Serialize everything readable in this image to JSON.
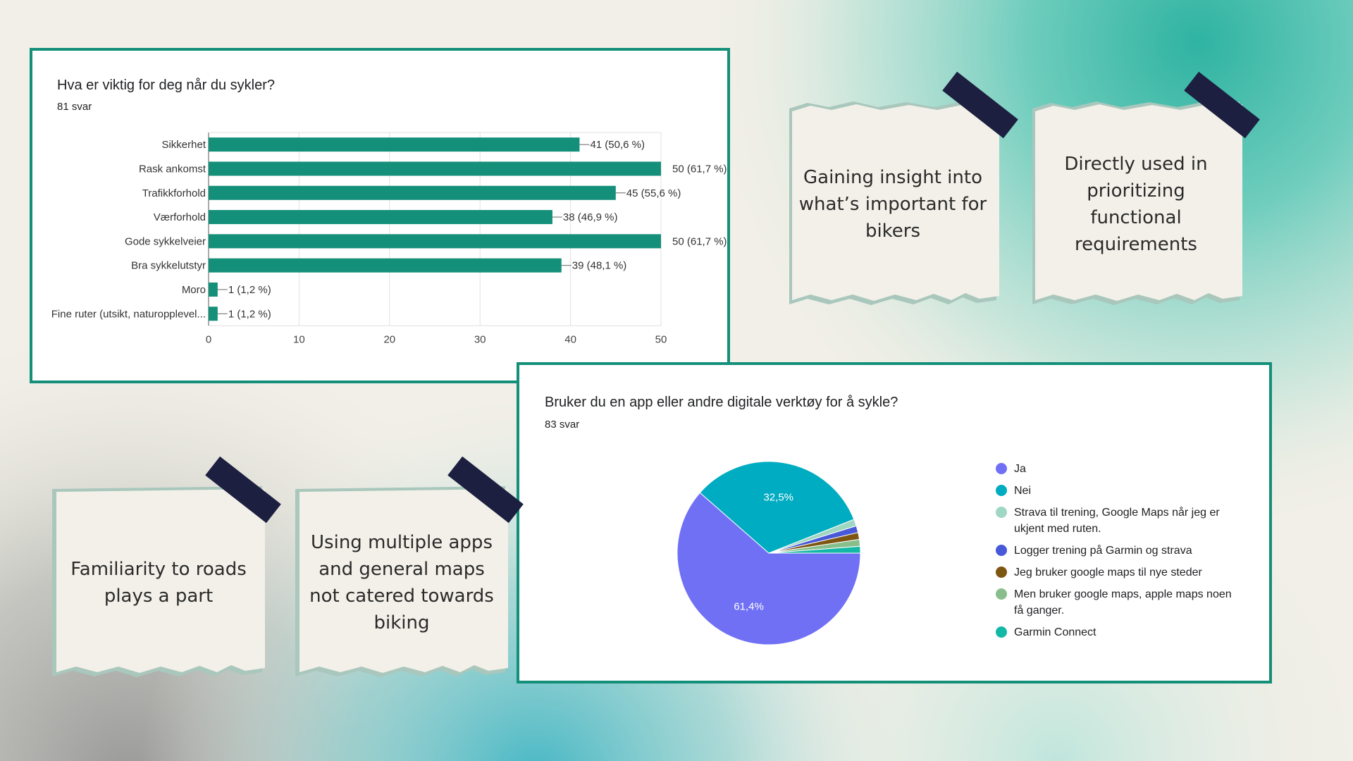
{
  "colors": {
    "accent": "#148f79",
    "bar": "#148f79",
    "tape": "#1c1f3f",
    "note": "#f2f0e8"
  },
  "bar_chart": {
    "title": "Hva er viktig for deg når du sykler?",
    "responses": "81 svar"
  },
  "pie_chart": {
    "title": "Bruker du en app eller andre digitale verktøy for å sykle?",
    "responses": "83 svar"
  },
  "notes": [
    {
      "text": "Gaining insight into what’s important for bikers"
    },
    {
      "text": "Directly used in prioritizing functional requirements"
    },
    {
      "text": "Familiarity to roads plays a part"
    },
    {
      "text": "Using multiple apps and general maps not catered towards biking"
    }
  ],
  "chart_data": [
    {
      "type": "bar",
      "orientation": "horizontal",
      "title": "Hva er viktig for deg når du sykler?",
      "categories": [
        "Sikkerhet",
        "Rask ankomst",
        "Trafikkforhold",
        "Værforhold",
        "Gode sykkelveier",
        "Bra sykkelutstyr",
        "Moro",
        "Fine ruter (utsikt, naturopplevel..."
      ],
      "values": [
        41,
        50,
        45,
        38,
        50,
        39,
        1,
        1
      ],
      "value_labels": [
        "41 (50,6 %)",
        "50 (61,7 %)",
        "45 (55,6 %)",
        "38 (46,9 %)",
        "50 (61,7 %)",
        "39 (48,1 %)",
        "1 (1,2 %)",
        "1 (1,2 %)"
      ],
      "xlim": [
        0,
        50
      ],
      "x_ticks": [
        "0",
        "10",
        "20",
        "30",
        "40",
        "50"
      ],
      "grid": true
    },
    {
      "type": "pie",
      "title": "Bruker du en app eller andre digitale verktøy for å sykle?",
      "labels": [
        "Ja",
        "Nei",
        "Strava til trening, Google Maps når jeg er ukjent med ruten.",
        "Logger trening på Garmin og strava",
        "Jeg bruker google maps til nye steder",
        "Men bruker google maps, apple maps noen få ganger.",
        "Garmin Connect"
      ],
      "values": [
        61.4,
        32.5,
        1.2,
        1.2,
        1.2,
        1.2,
        1.2
      ],
      "slice_labels": [
        "61,4%",
        "32,5%",
        "",
        "",
        "",
        "",
        ""
      ],
      "colors": [
        "#7070f5",
        "#00acc1",
        "#9fd7c3",
        "#4759d8",
        "#7d5611",
        "#87be8b",
        "#14b8a6"
      ],
      "legend_position": "right"
    }
  ]
}
